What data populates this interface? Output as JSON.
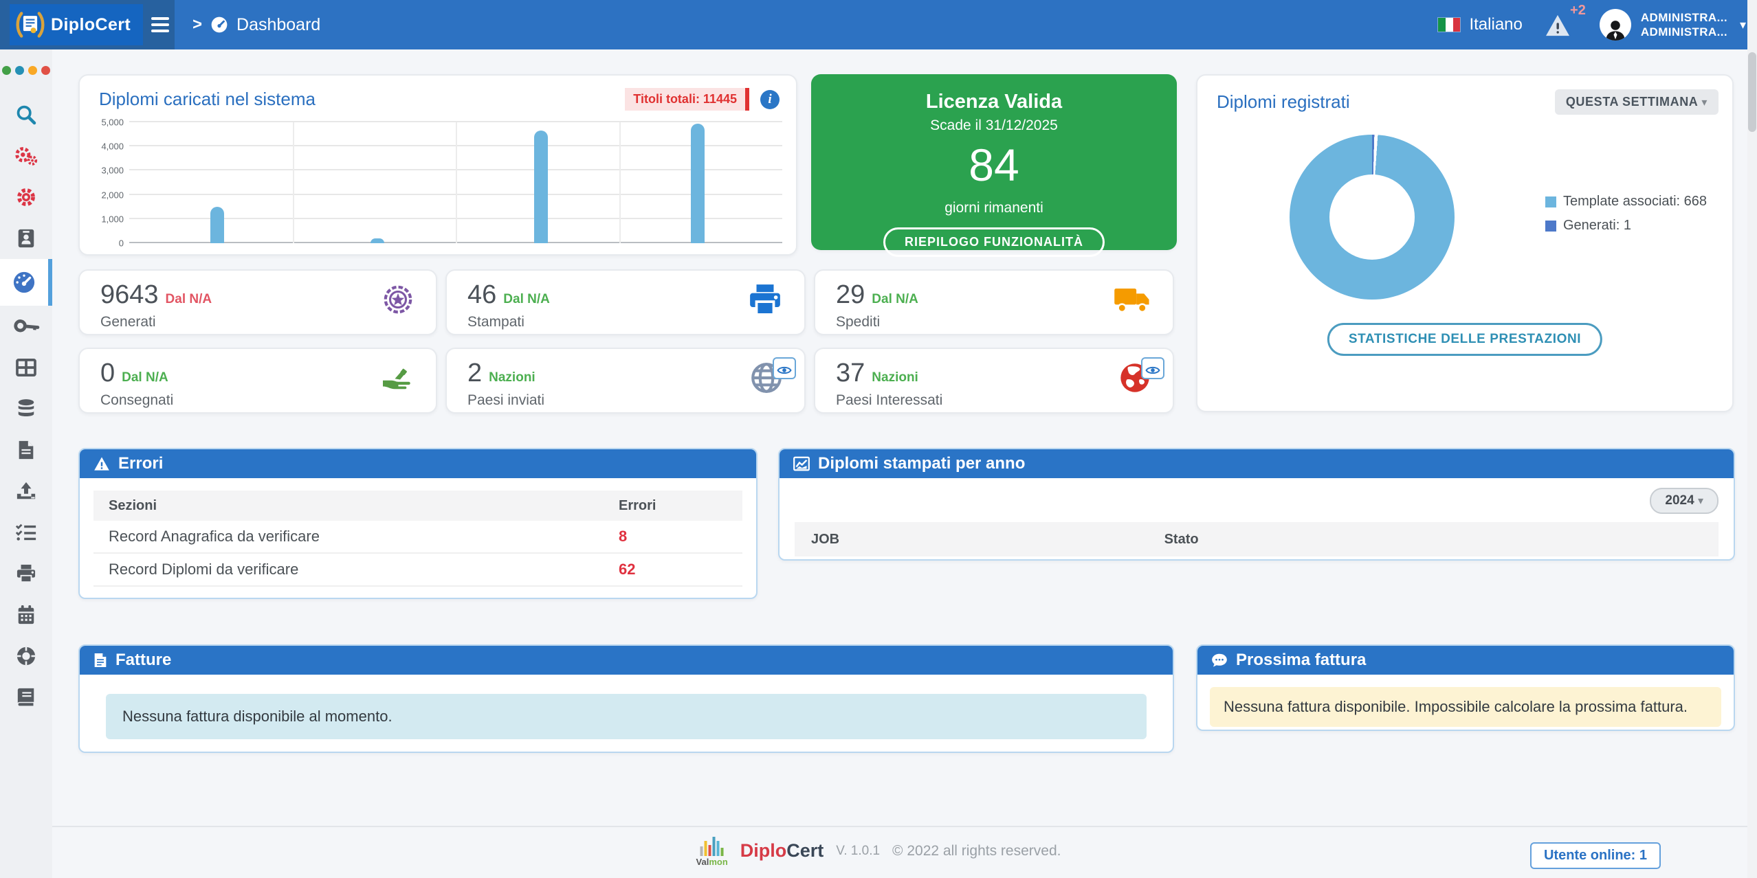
{
  "navbar": {
    "brand": "DiploCert",
    "breadcrumb_arrow": ">",
    "breadcrumb": "Dashboard",
    "language": "Italiano",
    "notification_badge": "+2",
    "user_line1": "ADMINISTRA...",
    "user_line2": "ADMINISTRA...",
    "caret": "▾"
  },
  "sidebar": {
    "dot_colors": [
      "#43a047",
      "#2590b5",
      "#f9a825",
      "#e05045"
    ],
    "items": [
      {
        "icon": "search-icon",
        "color": "#1e87ae"
      },
      {
        "icon": "gears-icon",
        "color": "#dc3545"
      },
      {
        "icon": "gear-icon",
        "color": "#dc3545"
      },
      {
        "icon": "id-card-icon",
        "color": "#565b61"
      },
      {
        "icon": "dashboard-gauge-icon",
        "color": "#3f74c4",
        "active": true
      },
      {
        "icon": "key-icon",
        "color": "#565b61"
      },
      {
        "icon": "table-icon",
        "color": "#565b61"
      },
      {
        "icon": "database-icon",
        "color": "#565b61"
      },
      {
        "icon": "document-icon",
        "color": "#565b61"
      },
      {
        "icon": "upload-icon",
        "color": "#565b61"
      },
      {
        "icon": "checklist-icon",
        "color": "#565b61"
      },
      {
        "icon": "printer-icon",
        "color": "#565b61"
      },
      {
        "icon": "calendar-icon",
        "color": "#565b61"
      },
      {
        "icon": "life-ring-icon",
        "color": "#565b61"
      },
      {
        "icon": "book-icon",
        "color": "#565b61"
      }
    ]
  },
  "uploaded_chart": {
    "title": "Diplomi caricati nel sistema",
    "total_badge": "Titoli totali: 11445",
    "info_icon": "i"
  },
  "license": {
    "title": "Licenza Valida",
    "subtitle": "Scade il 31/12/2025",
    "days": "84",
    "days_label": "giorni rimanenti",
    "button": "RIEPILOGO FUNZIONALITÀ",
    "bg_color": "#2ba24f"
  },
  "registered": {
    "title": "Diplomi registrati",
    "period_button": "QUESTA SETTIMANA",
    "legend": [
      {
        "label": "Template associati: 668",
        "color": "#6cb5de"
      },
      {
        "label": "Generati: 1",
        "color": "#4d79c9"
      }
    ],
    "stats_button": "STATISTICHE DELLE PRESTAZIONI"
  },
  "stat_cards": [
    {
      "value": "9643",
      "sub": "Dal N/A",
      "sub_color": "#e25563",
      "label": "Generati",
      "icon": "certificate-badge-icon",
      "icon_color": "#7d57a5"
    },
    {
      "value": "46",
      "sub": "Dal N/A",
      "sub_color": "#4caf50",
      "label": "Stampati",
      "icon": "printer-icon",
      "icon_color": "#1b74d2"
    },
    {
      "value": "29",
      "sub": "Dal N/A",
      "sub_color": "#4caf50",
      "label": "Spediti",
      "icon": "truck-icon",
      "icon_color": "#f59b00"
    },
    {
      "value": "0",
      "sub": "Dal N/A",
      "sub_color": "#4caf50",
      "label": "Consegnati",
      "icon": "hand-receive-icon",
      "icon_color": "#569b44"
    },
    {
      "value": "2",
      "sub": "Nazioni",
      "sub_color": "#4caf50",
      "label": "Paesi inviati",
      "icon": "globe-icon",
      "icon_color": "#8192ad",
      "has_eye": true
    },
    {
      "value": "37",
      "sub": "Nazioni",
      "sub_color": "#4caf50",
      "label": "Paesi Interessati",
      "icon": "globe-red-icon",
      "icon_color": "#d63229",
      "has_eye": true
    }
  ],
  "errors_panel": {
    "title": "Errori",
    "columns": {
      "col1": "Sezioni",
      "col2": "Errori"
    },
    "rows": [
      {
        "section": "Record Anagrafica da verificare",
        "count": "8"
      },
      {
        "section": "Record Diplomi da verificare",
        "count": "62"
      }
    ]
  },
  "printed_panel": {
    "title": "Diplomi stampati per anno",
    "year_button": "2024",
    "columns": {
      "col1": "JOB",
      "col2": "Stato"
    }
  },
  "invoices_panel": {
    "title": "Fatture",
    "message": "Nessuna fattura disponibile al momento."
  },
  "next_invoice_panel": {
    "title": "Prossima fattura",
    "message": "Nessuna fattura disponibile. Impossibile calcolare la prossima fattura."
  },
  "footer": {
    "logo_text_dark": "Val",
    "logo_text_green": "mon",
    "brand_red": "Diplo",
    "brand_dark": "Cert",
    "version": "V. 1.0.1",
    "copyright": "© 2022 all rights reserved.",
    "online_badge": "Utente online: 1"
  },
  "colors": {
    "navbar": "#2d72c2",
    "panel_header": "#2a74c6",
    "heading_blue": "#2a6fbf",
    "bar_blue": "#6cb5de",
    "error_red": "#e0313f"
  },
  "chart_data": [
    {
      "type": "bar",
      "title": "Diplomi caricati nel sistema",
      "categories": [
        "",
        "",
        "",
        ""
      ],
      "values": [
        1500,
        200,
        4650,
        4950
      ],
      "bar_color": "#6cb5de",
      "ylim": [
        0,
        5000
      ],
      "yticks": [
        0,
        1000,
        2000,
        3000,
        4000,
        5000
      ],
      "ytick_labels": [
        "0",
        "1,000",
        "2,000",
        "3,000",
        "4,000",
        "5,000"
      ],
      "x_fractions": [
        0.135,
        0.38,
        0.63,
        0.87
      ],
      "vertical_gridline_fractions": [
        0.25,
        0.5,
        0.75
      ],
      "grid": true,
      "legend": false
    },
    {
      "type": "pie",
      "title": "Diplomi registrati",
      "donut": true,
      "series": [
        {
          "name": "Template associati",
          "value": 668,
          "color": "#6cb5de"
        },
        {
          "name": "Generati",
          "value": 1,
          "color": "#4d79c9"
        }
      ],
      "legend_position": "right"
    }
  ]
}
